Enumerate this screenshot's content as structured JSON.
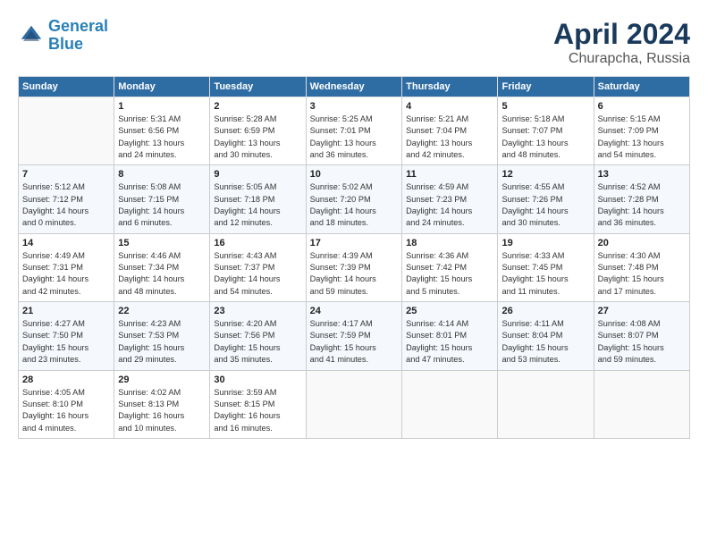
{
  "header": {
    "logo_line1": "General",
    "logo_line2": "Blue",
    "month": "April 2024",
    "location": "Churapcha, Russia"
  },
  "columns": [
    "Sunday",
    "Monday",
    "Tuesday",
    "Wednesday",
    "Thursday",
    "Friday",
    "Saturday"
  ],
  "weeks": [
    [
      {
        "day": "",
        "info": ""
      },
      {
        "day": "1",
        "info": "Sunrise: 5:31 AM\nSunset: 6:56 PM\nDaylight: 13 hours\nand 24 minutes."
      },
      {
        "day": "2",
        "info": "Sunrise: 5:28 AM\nSunset: 6:59 PM\nDaylight: 13 hours\nand 30 minutes."
      },
      {
        "day": "3",
        "info": "Sunrise: 5:25 AM\nSunset: 7:01 PM\nDaylight: 13 hours\nand 36 minutes."
      },
      {
        "day": "4",
        "info": "Sunrise: 5:21 AM\nSunset: 7:04 PM\nDaylight: 13 hours\nand 42 minutes."
      },
      {
        "day": "5",
        "info": "Sunrise: 5:18 AM\nSunset: 7:07 PM\nDaylight: 13 hours\nand 48 minutes."
      },
      {
        "day": "6",
        "info": "Sunrise: 5:15 AM\nSunset: 7:09 PM\nDaylight: 13 hours\nand 54 minutes."
      }
    ],
    [
      {
        "day": "7",
        "info": "Sunrise: 5:12 AM\nSunset: 7:12 PM\nDaylight: 14 hours\nand 0 minutes."
      },
      {
        "day": "8",
        "info": "Sunrise: 5:08 AM\nSunset: 7:15 PM\nDaylight: 14 hours\nand 6 minutes."
      },
      {
        "day": "9",
        "info": "Sunrise: 5:05 AM\nSunset: 7:18 PM\nDaylight: 14 hours\nand 12 minutes."
      },
      {
        "day": "10",
        "info": "Sunrise: 5:02 AM\nSunset: 7:20 PM\nDaylight: 14 hours\nand 18 minutes."
      },
      {
        "day": "11",
        "info": "Sunrise: 4:59 AM\nSunset: 7:23 PM\nDaylight: 14 hours\nand 24 minutes."
      },
      {
        "day": "12",
        "info": "Sunrise: 4:55 AM\nSunset: 7:26 PM\nDaylight: 14 hours\nand 30 minutes."
      },
      {
        "day": "13",
        "info": "Sunrise: 4:52 AM\nSunset: 7:28 PM\nDaylight: 14 hours\nand 36 minutes."
      }
    ],
    [
      {
        "day": "14",
        "info": "Sunrise: 4:49 AM\nSunset: 7:31 PM\nDaylight: 14 hours\nand 42 minutes."
      },
      {
        "day": "15",
        "info": "Sunrise: 4:46 AM\nSunset: 7:34 PM\nDaylight: 14 hours\nand 48 minutes."
      },
      {
        "day": "16",
        "info": "Sunrise: 4:43 AM\nSunset: 7:37 PM\nDaylight: 14 hours\nand 54 minutes."
      },
      {
        "day": "17",
        "info": "Sunrise: 4:39 AM\nSunset: 7:39 PM\nDaylight: 14 hours\nand 59 minutes."
      },
      {
        "day": "18",
        "info": "Sunrise: 4:36 AM\nSunset: 7:42 PM\nDaylight: 15 hours\nand 5 minutes."
      },
      {
        "day": "19",
        "info": "Sunrise: 4:33 AM\nSunset: 7:45 PM\nDaylight: 15 hours\nand 11 minutes."
      },
      {
        "day": "20",
        "info": "Sunrise: 4:30 AM\nSunset: 7:48 PM\nDaylight: 15 hours\nand 17 minutes."
      }
    ],
    [
      {
        "day": "21",
        "info": "Sunrise: 4:27 AM\nSunset: 7:50 PM\nDaylight: 15 hours\nand 23 minutes."
      },
      {
        "day": "22",
        "info": "Sunrise: 4:23 AM\nSunset: 7:53 PM\nDaylight: 15 hours\nand 29 minutes."
      },
      {
        "day": "23",
        "info": "Sunrise: 4:20 AM\nSunset: 7:56 PM\nDaylight: 15 hours\nand 35 minutes."
      },
      {
        "day": "24",
        "info": "Sunrise: 4:17 AM\nSunset: 7:59 PM\nDaylight: 15 hours\nand 41 minutes."
      },
      {
        "day": "25",
        "info": "Sunrise: 4:14 AM\nSunset: 8:01 PM\nDaylight: 15 hours\nand 47 minutes."
      },
      {
        "day": "26",
        "info": "Sunrise: 4:11 AM\nSunset: 8:04 PM\nDaylight: 15 hours\nand 53 minutes."
      },
      {
        "day": "27",
        "info": "Sunrise: 4:08 AM\nSunset: 8:07 PM\nDaylight: 15 hours\nand 59 minutes."
      }
    ],
    [
      {
        "day": "28",
        "info": "Sunrise: 4:05 AM\nSunset: 8:10 PM\nDaylight: 16 hours\nand 4 minutes."
      },
      {
        "day": "29",
        "info": "Sunrise: 4:02 AM\nSunset: 8:13 PM\nDaylight: 16 hours\nand 10 minutes."
      },
      {
        "day": "30",
        "info": "Sunrise: 3:59 AM\nSunset: 8:15 PM\nDaylight: 16 hours\nand 16 minutes."
      },
      {
        "day": "",
        "info": ""
      },
      {
        "day": "",
        "info": ""
      },
      {
        "day": "",
        "info": ""
      },
      {
        "day": "",
        "info": ""
      }
    ]
  ]
}
